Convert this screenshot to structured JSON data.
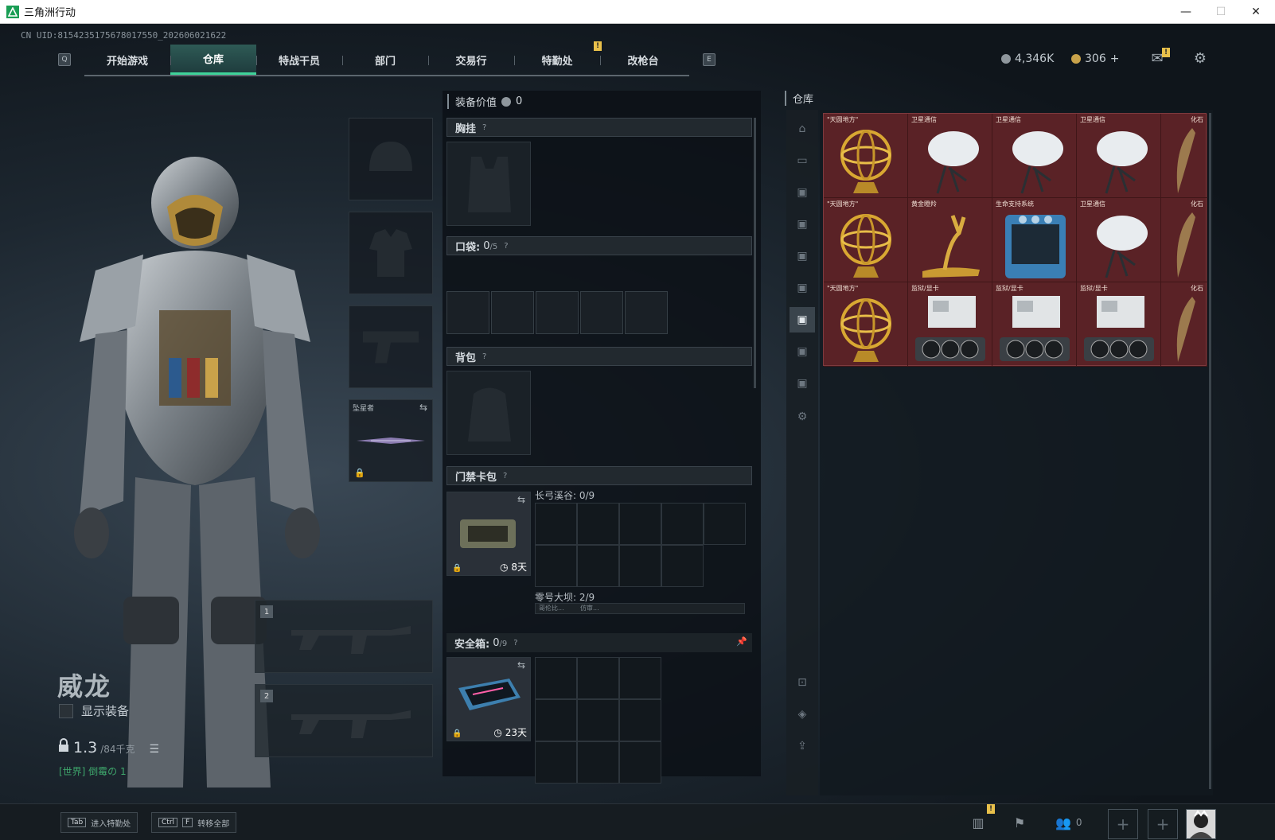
{
  "window": {
    "title": "三角洲行动"
  },
  "uid": "CN UID:8154235175678017550_202606021622",
  "nav": {
    "key_left": "Q",
    "key_right": "E",
    "tabs": [
      {
        "label": "开始游戏"
      },
      {
        "label": "仓库",
        "active": true
      },
      {
        "label": "特战干员"
      },
      {
        "label": "部门"
      },
      {
        "label": "交易行"
      },
      {
        "label": "特勤处"
      },
      {
        "label": "改枪台"
      }
    ],
    "notice_badge": "!"
  },
  "currency": {
    "havoc": "4,346K",
    "coins": "306",
    "plus": "+"
  },
  "character": {
    "name": "威龙",
    "show_equipment": "显示装备",
    "weight": "1.3",
    "weight_max": "/84千克",
    "chat": "[世界] 倒霉の 1"
  },
  "equip": {
    "melee_name": "坠星者"
  },
  "weapons": {
    "slot1": "1",
    "slot2": "2"
  },
  "middle": {
    "equip_value_label": "装备价值",
    "equip_value": "0",
    "chest_rig": "胸挂",
    "pocket": "口袋:",
    "pocket_count": "0",
    "pocket_max": "/5",
    "backpack": "背包",
    "keycard": "门禁卡包",
    "keycard_map1": "长弓溪谷: 0/9",
    "keycard_map2": "零号大坝: 2/9",
    "keycard_days": "8天",
    "keycard_sub1": "哥伦比...",
    "keycard_sub2": "仿审...",
    "safe_box": "安全箱:",
    "safe_count": "0",
    "safe_max": "/9",
    "safe_days": "23天",
    "help": "?"
  },
  "warehouse": {
    "title": "仓库",
    "rows": [
      [
        "\"天圆地方\"",
        "卫星通信",
        "卫星通信",
        "卫星通信",
        "化石"
      ],
      [
        "\"天圆地方\"",
        "黄金瞪羚",
        "生命支持系统",
        "卫星通信",
        "化石"
      ],
      [
        "\"天圆地方\"",
        "监狱/显卡",
        "监狱/显卡",
        "监狱/显卡",
        "化石"
      ]
    ]
  },
  "bottom": {
    "hotkey1_key": "Tab",
    "hotkey1_label": "进入特勤处",
    "hotkey2_key1": "Ctrl",
    "hotkey2_key2": "F",
    "hotkey2_label": "转移全部",
    "friends_count": "0",
    "plus": "+"
  },
  "colors": {
    "accent": "#3fd39a",
    "warehouse_bg": "#5a2226",
    "warn": "#e8c04a"
  }
}
